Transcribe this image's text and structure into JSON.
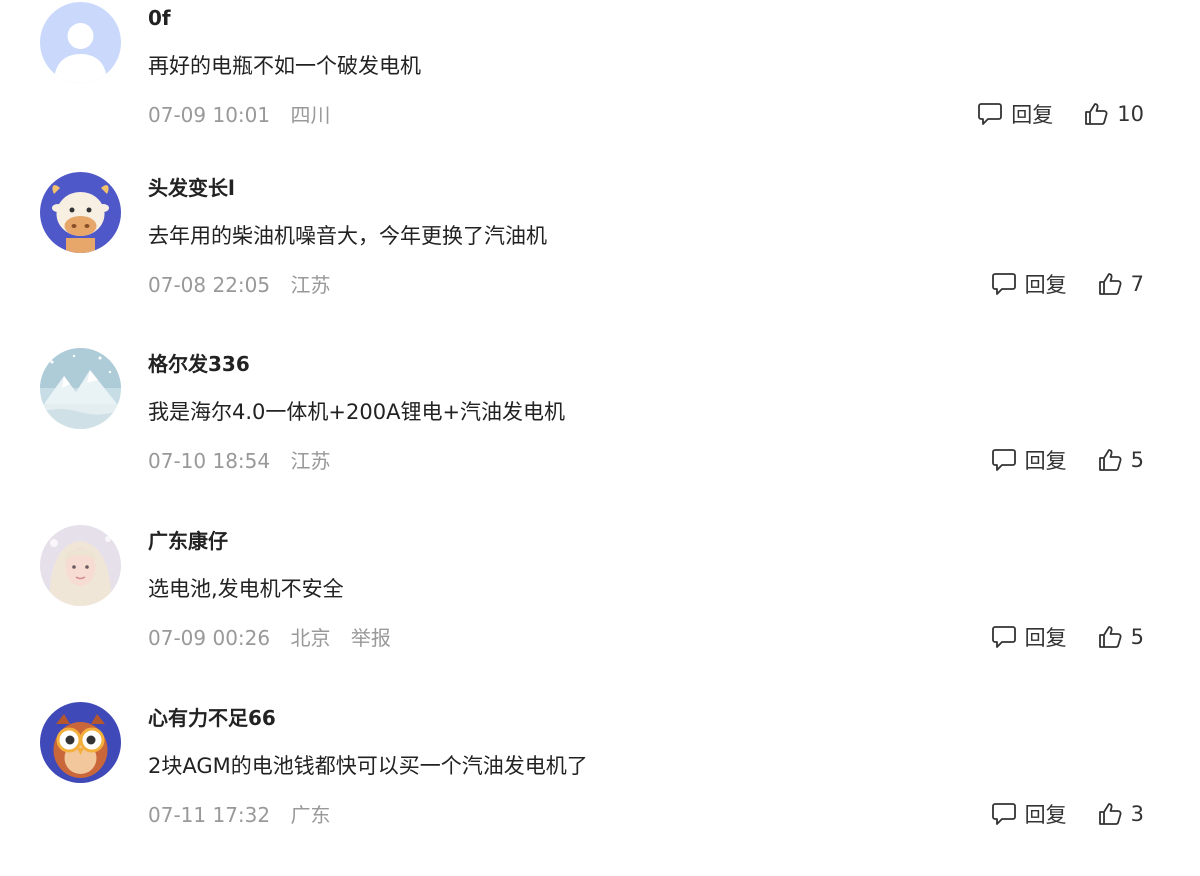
{
  "comments": [
    {
      "username": "0f",
      "content": "再好的电瓶不如一个破发电机",
      "time": "07-09 10:01",
      "location": "四川",
      "reply_label": "回复",
      "likes": "10",
      "avatar_icon": "default-avatar-icon"
    },
    {
      "username": "头发变长l",
      "content": "去年用的柴油机噪音大，今年更换了汽油机",
      "time": "07-08 22:05",
      "location": "江苏",
      "reply_label": "回复",
      "likes": "7",
      "avatar_icon": "cow-avatar-icon"
    },
    {
      "username": "格尔发336",
      "content": "我是海尔4.0一体机+200A锂电+汽油发电机",
      "time": "07-10 18:54",
      "location": "江苏",
      "reply_label": "回复",
      "likes": "5",
      "avatar_icon": "snow-mountain-avatar-icon"
    },
    {
      "username": "广东康仔",
      "content": "选电池,发电机不安全",
      "time": "07-09 00:26",
      "location": "北京",
      "report_label": "举报",
      "reply_label": "回复",
      "likes": "5",
      "avatar_icon": "photo-avatar-icon"
    },
    {
      "username": "心有力不足66",
      "content": "2块AGM的电池钱都快可以买一个汽油发电机了",
      "time": "07-11 17:32",
      "location": "广东",
      "reply_label": "回复",
      "likes": "3",
      "avatar_icon": "owl-avatar-icon"
    }
  ]
}
